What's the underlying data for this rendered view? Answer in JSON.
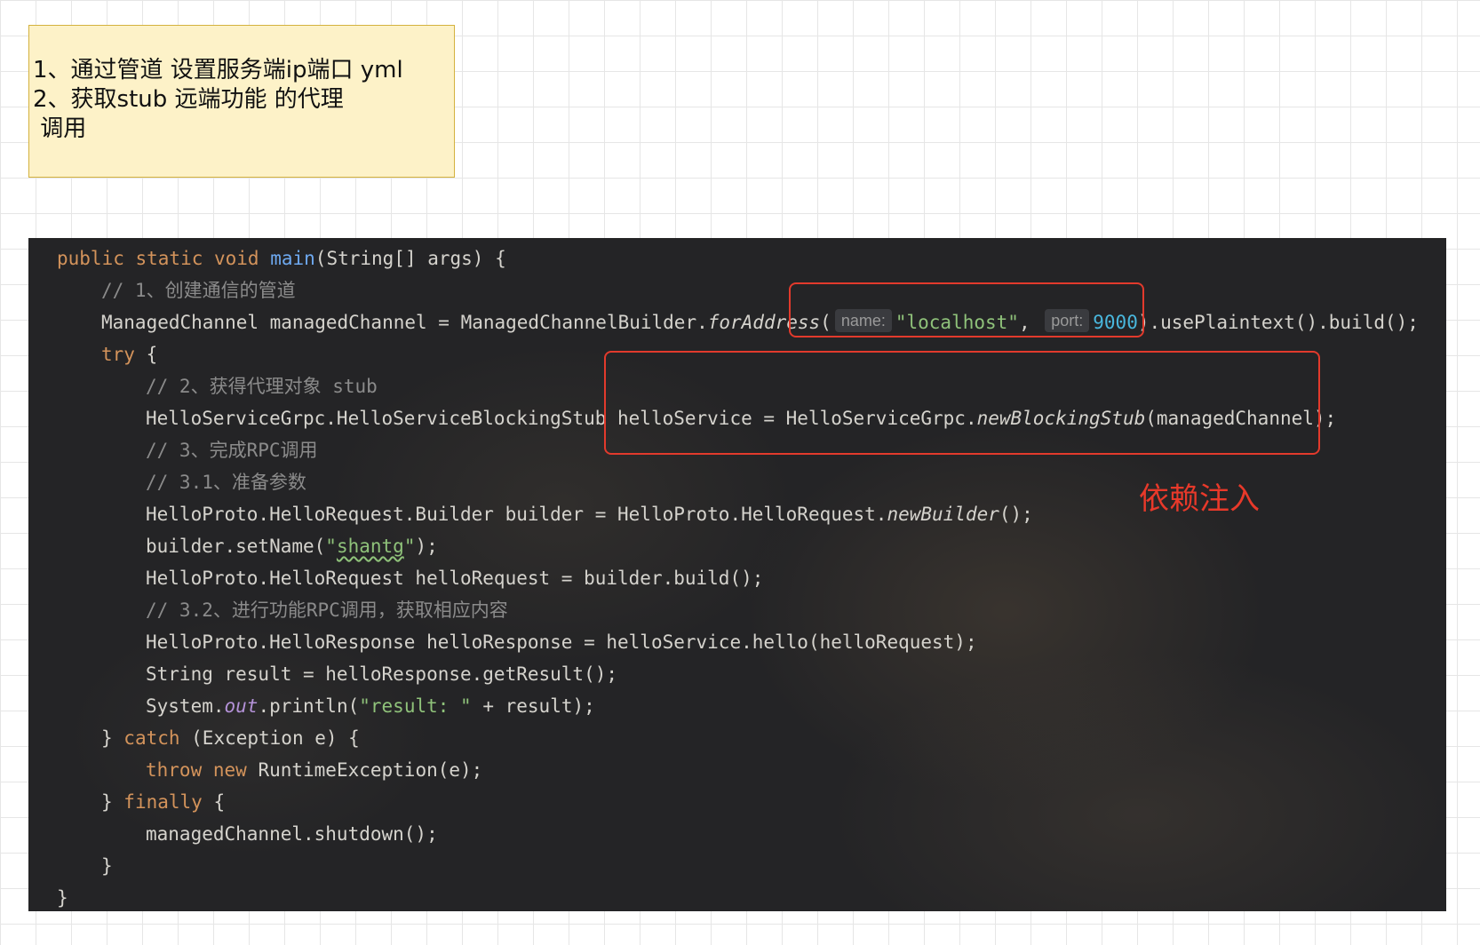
{
  "note": {
    "lines": [
      "1、通过管道 设置服务端ip端口 yml",
      "2、获取stub 远端功能 的代理",
      " 调用"
    ]
  },
  "annotation": {
    "text": "依赖注入"
  },
  "code": {
    "colors": {
      "background": "#242426",
      "keyword": "#d3935b",
      "method": "#6ea9f0",
      "string": "#8fc27a",
      "number": "#49b7dd",
      "comment": "#8b8b8b",
      "default": "#d5d3cd",
      "highlight_box": "#e23a2c"
    },
    "lines": [
      {
        "indent": 1,
        "tokens": [
          {
            "t": "public static void ",
            "c": "kw"
          },
          {
            "t": "main",
            "c": "fn"
          },
          {
            "t": "(String[] args) {"
          }
        ]
      },
      {
        "indent": 2,
        "tokens": [
          {
            "t": "// 1、创建通信的管道",
            "c": "cm"
          }
        ]
      },
      {
        "indent": 2,
        "tokens": [
          {
            "t": "ManagedChannel managedChannel = ManagedChannelBuilder."
          },
          {
            "t": "forAddress",
            "c": "it"
          },
          {
            "t": "("
          },
          {
            "t": "name:",
            "c": "hint"
          },
          {
            "t": "\"localhost\"",
            "c": "str"
          },
          {
            "t": ", "
          },
          {
            "t": "port:",
            "c": "hint"
          },
          {
            "t": "9000",
            "c": "num"
          },
          {
            "t": ").usePlaintext().build();"
          }
        ]
      },
      {
        "indent": 2,
        "tokens": [
          {
            "t": "try",
            "c": "kw"
          },
          {
            "t": " {"
          }
        ]
      },
      {
        "indent": 3,
        "tokens": [
          {
            "t": "// 2、获得代理对象 stub",
            "c": "cm"
          }
        ]
      },
      {
        "indent": 3,
        "tokens": [
          {
            "t": "HelloServiceGrpc.HelloServiceBlockingStub helloService = HelloServiceGrpc."
          },
          {
            "t": "newBlockingStub",
            "c": "it"
          },
          {
            "t": "(managedChannel);"
          }
        ]
      },
      {
        "indent": 3,
        "tokens": [
          {
            "t": "// 3、完成RPC调用",
            "c": "cm"
          }
        ]
      },
      {
        "indent": 3,
        "tokens": [
          {
            "t": "// 3.1、准备参数",
            "c": "cm"
          }
        ]
      },
      {
        "indent": 3,
        "tokens": [
          {
            "t": "HelloProto.HelloRequest.Builder builder = HelloProto.HelloRequest."
          },
          {
            "t": "newBuilder",
            "c": "it"
          },
          {
            "t": "();"
          }
        ]
      },
      {
        "indent": 3,
        "tokens": [
          {
            "t": "builder.setName("
          },
          {
            "t": "\"",
            "c": "str"
          },
          {
            "t": "shantg",
            "c": "str squig"
          },
          {
            "t": "\"",
            "c": "str"
          },
          {
            "t": ");"
          }
        ]
      },
      {
        "indent": 3,
        "tokens": [
          {
            "t": "HelloProto.HelloRequest helloRequest = builder.build();"
          }
        ]
      },
      {
        "indent": 3,
        "tokens": [
          {
            "t": "// 3.2、进行功能RPC调用，获取相应内容",
            "c": "cm"
          }
        ]
      },
      {
        "indent": 3,
        "tokens": [
          {
            "t": "HelloProto.HelloResponse helloResponse = helloService.hello(helloRequest);"
          }
        ]
      },
      {
        "indent": 3,
        "tokens": [
          {
            "t": "String result = helloResponse.getResult();"
          }
        ]
      },
      {
        "indent": 3,
        "tokens": [
          {
            "t": "System."
          },
          {
            "t": "out",
            "c": "field"
          },
          {
            "t": ".println("
          },
          {
            "t": "\"result: \"",
            "c": "str"
          },
          {
            "t": " + result);"
          }
        ]
      },
      {
        "indent": 2,
        "tokens": [
          {
            "t": "} "
          },
          {
            "t": "catch",
            "c": "kw"
          },
          {
            "t": " (Exception e) {"
          }
        ]
      },
      {
        "indent": 3,
        "tokens": [
          {
            "t": "throw new ",
            "c": "kw"
          },
          {
            "t": "RuntimeException(e);"
          }
        ]
      },
      {
        "indent": 2,
        "tokens": [
          {
            "t": "} "
          },
          {
            "t": "finally",
            "c": "kw"
          },
          {
            "t": " {"
          }
        ]
      },
      {
        "indent": 3,
        "tokens": [
          {
            "t": "managedChannel.shutdown();"
          }
        ]
      },
      {
        "indent": 2,
        "tokens": [
          {
            "t": "}"
          }
        ]
      },
      {
        "indent": 1,
        "tokens": [
          {
            "t": "}"
          }
        ]
      }
    ]
  }
}
